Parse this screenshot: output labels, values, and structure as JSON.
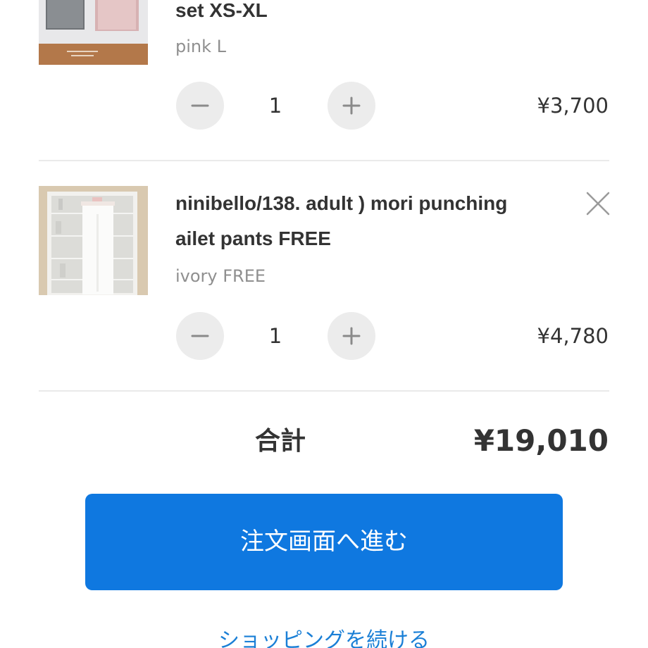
{
  "cart": {
    "items": [
      {
        "title_lines": [
          "set XS-XL"
        ],
        "variant": "pink L",
        "quantity": "1",
        "price": "¥3,700",
        "thumbnail_icon": "product-photo-pink-set"
      },
      {
        "title_lines": [
          "ninibello/138. adult ) mori punching",
          "ailet pants FREE"
        ],
        "variant": "ivory FREE",
        "quantity": "1",
        "price": "¥4,780",
        "thumbnail_icon": "product-photo-ivory-pants"
      }
    ],
    "decrement_icon": "minus-icon",
    "increment_icon": "plus-icon",
    "remove_icon": "close-icon"
  },
  "summary": {
    "total_label": "合計",
    "total_value": "¥19,010"
  },
  "actions": {
    "checkout_label": "注文画面へ進む",
    "continue_label": "ショッピングを続ける"
  },
  "colors": {
    "primary_button": "#0f78e0",
    "link": "#1a7fd6",
    "text": "#333333",
    "muted_text": "#8f8f8f",
    "qty_button_bg": "#ececec",
    "divider": "#eaeaea"
  }
}
